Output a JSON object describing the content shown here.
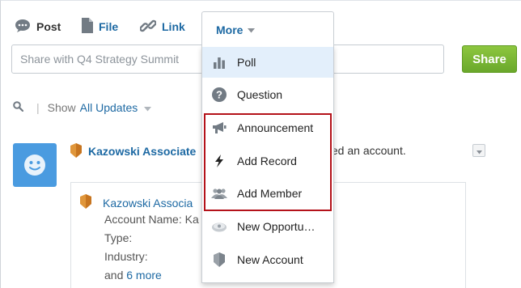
{
  "publisher": {
    "tabs": [
      {
        "label": "Post",
        "icon": "speech-bubble-icon"
      },
      {
        "label": "File",
        "icon": "document-icon"
      },
      {
        "label": "Link",
        "icon": "link-icon"
      }
    ],
    "more_label": "More",
    "input_placeholder": "Share with Q4 Strategy Summit",
    "share_label": "Share"
  },
  "filter": {
    "show_label": "Show",
    "value": "All Updates"
  },
  "feed_item": {
    "author": "Kazowski Associate",
    "action_tail": "ted an account.",
    "card": {
      "title": "Kazowski Associa",
      "fields": [
        "Account Name: Ka",
        "Type:",
        "Industry:"
      ],
      "more_prefix": "and ",
      "more_link": "6 more"
    }
  },
  "menu": {
    "items": [
      {
        "label": "Poll",
        "icon": "bar-chart-icon",
        "active": true
      },
      {
        "label": "Question",
        "icon": "question-icon"
      },
      {
        "label": "Announcement",
        "icon": "megaphone-icon"
      },
      {
        "label": "Add Record",
        "icon": "lightning-icon"
      },
      {
        "label": "Add Member",
        "icon": "people-icon"
      },
      {
        "label": "New Opportu…",
        "icon": "opportunity-icon"
      },
      {
        "label": "New Account",
        "icon": "account-icon"
      }
    ]
  },
  "colors": {
    "link": "#1d69a3",
    "share_green": "#7ab534",
    "highlight_red": "#b4121a",
    "active_row": "#e3effb"
  }
}
